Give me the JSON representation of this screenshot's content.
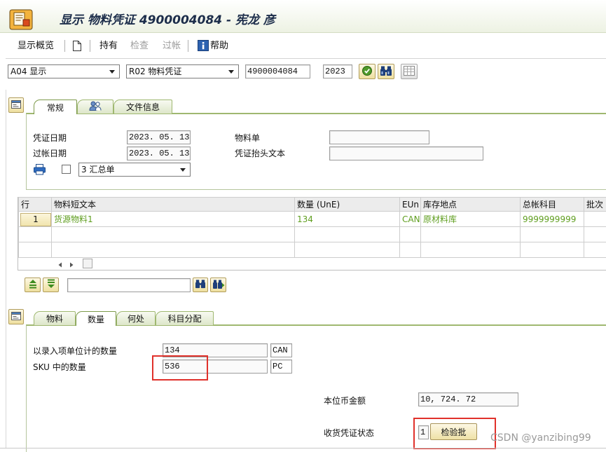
{
  "window": {
    "title": "显示 物料凭证 4900004084 - 宪龙 彦",
    "title_icon": "transaction-icon"
  },
  "toolbar": {
    "overview_label": "显示概览",
    "other_doc_icon": "other-document-icon",
    "hold_label": "持有",
    "check_label": "检查",
    "check_enabled": false,
    "post_label": "过帐",
    "post_enabled": false,
    "help_icon": "info-icon",
    "help_label": "帮助"
  },
  "selection": {
    "action": "A04 显示",
    "reference_doc": "R02 物料凭证",
    "doc_number": "4900004084",
    "year": "2023",
    "buttons": [
      "execute-icon",
      "binoculars-icon",
      "grid-icon"
    ]
  },
  "header_tabs": {
    "items": [
      {
        "label": "常规",
        "active": true
      },
      {
        "icon": "people-icon",
        "active": false
      },
      {
        "label": "文件信息",
        "active": false
      }
    ]
  },
  "header": {
    "doc_date_label": "凭证日期",
    "doc_date": "2023. 05. 13",
    "posting_date_label": "过帐日期",
    "posting_date": "2023. 05. 13",
    "delivery_note_label": "物料单",
    "delivery_note": "",
    "header_text_label": "凭证抬头文本",
    "header_text": "",
    "print_checked": false,
    "print_version": "3 汇总单"
  },
  "items_table": {
    "columns": [
      "行",
      "物料短文本",
      "数量 (UnE)",
      "EUn",
      "库存地点",
      "总帐科目",
      "批次"
    ],
    "rows": [
      {
        "line": "1",
        "short_text": "货源物料1",
        "quantity": "134",
        "unit": "CAN",
        "storage_location": "原材料库",
        "gl_account": "9999999999"
      }
    ]
  },
  "detail_tabs": {
    "items": [
      {
        "label": "物料",
        "active": false
      },
      {
        "label": "数量",
        "active": true
      },
      {
        "label": "何处",
        "active": false
      },
      {
        "label": "科目分配",
        "active": false
      }
    ]
  },
  "quantity": {
    "entry_qty_label": "以录入项单位计的数量",
    "entry_qty": "134",
    "entry_unit": "CAN",
    "sku_qty_label": "SKU 中的数量",
    "sku_qty": "536",
    "sku_unit": "PC",
    "amount_label": "本位币金额",
    "amount": "10, 724. 72",
    "gr_status_label": "收货凭证状态",
    "gr_status": "1",
    "inspection_lot_button": "检验批"
  },
  "watermark": "CSDN @yanzibing99",
  "colors": {
    "item_text": "#5f9e1f",
    "highlight": "#e0312b",
    "tab_border": "#9fb870",
    "title_text": "#1c2d4a"
  }
}
